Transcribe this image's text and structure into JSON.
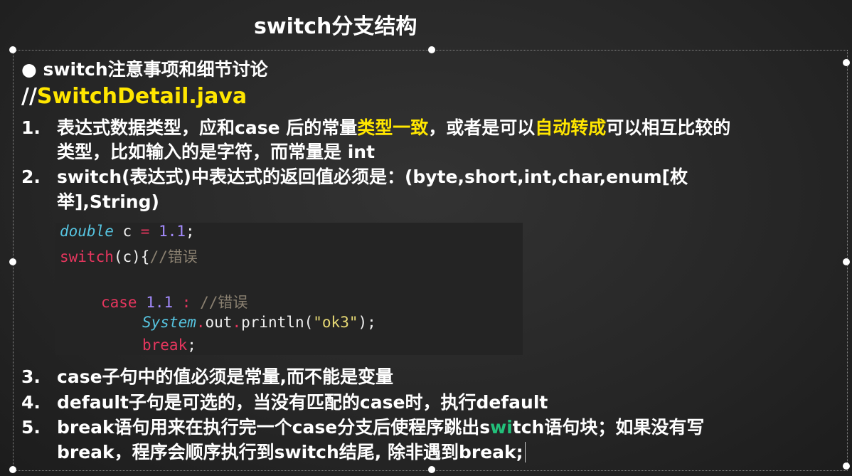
{
  "title": "switch分支结构",
  "bullet": "switch注意事项和细节讨论",
  "file_prefix": "//",
  "file_name": "SwitchDetail.java",
  "items": [
    {
      "num": "1.",
      "parts": [
        "表达式数据类型，应和case 后的常量",
        "类型一致",
        "，或者是可以",
        "自动转成",
        "可以相互比较的"
      ],
      "line2": "类型，比如输入的是字符，而常量是 int"
    },
    {
      "num": "2.",
      "text": "switch(表达式)中表达式的返回值必须是：(byte,short,int,char,enum[枚",
      "line2": "举],String)"
    },
    {
      "num": "3.",
      "text": "case子句中的值必须是常量,而不能是变量"
    },
    {
      "num": "4.",
      "text": "default子句是可选的，当没有匹配的case时，执行default"
    },
    {
      "num": "5.",
      "text_a": "break语句用来在执行完一个case分支后使程序跳出s",
      "text_hl": "wi",
      "text_b": "tch语句块；如果没有写",
      "line2": "break，程序会顺序执行到switch结尾, 除非遇到break;"
    }
  ],
  "code": {
    "l1": {
      "type": "double",
      "var": " c ",
      "op": "=",
      "num": " 1.1",
      "end": ";"
    },
    "l2": {
      "kw": "switch",
      "rest": "(c){",
      "cm": "//错误"
    },
    "l4": {
      "kw": "case",
      "num": " 1.1 ",
      "op": ":",
      "cm": " //错误"
    },
    "l5": {
      "cls": "System",
      "dot1": ".",
      "out": "out",
      "dot2": ".",
      "call": "println(",
      "str": "\"ok3\"",
      "end": ");"
    },
    "l6": {
      "kw": "break",
      "end": ";"
    }
  }
}
